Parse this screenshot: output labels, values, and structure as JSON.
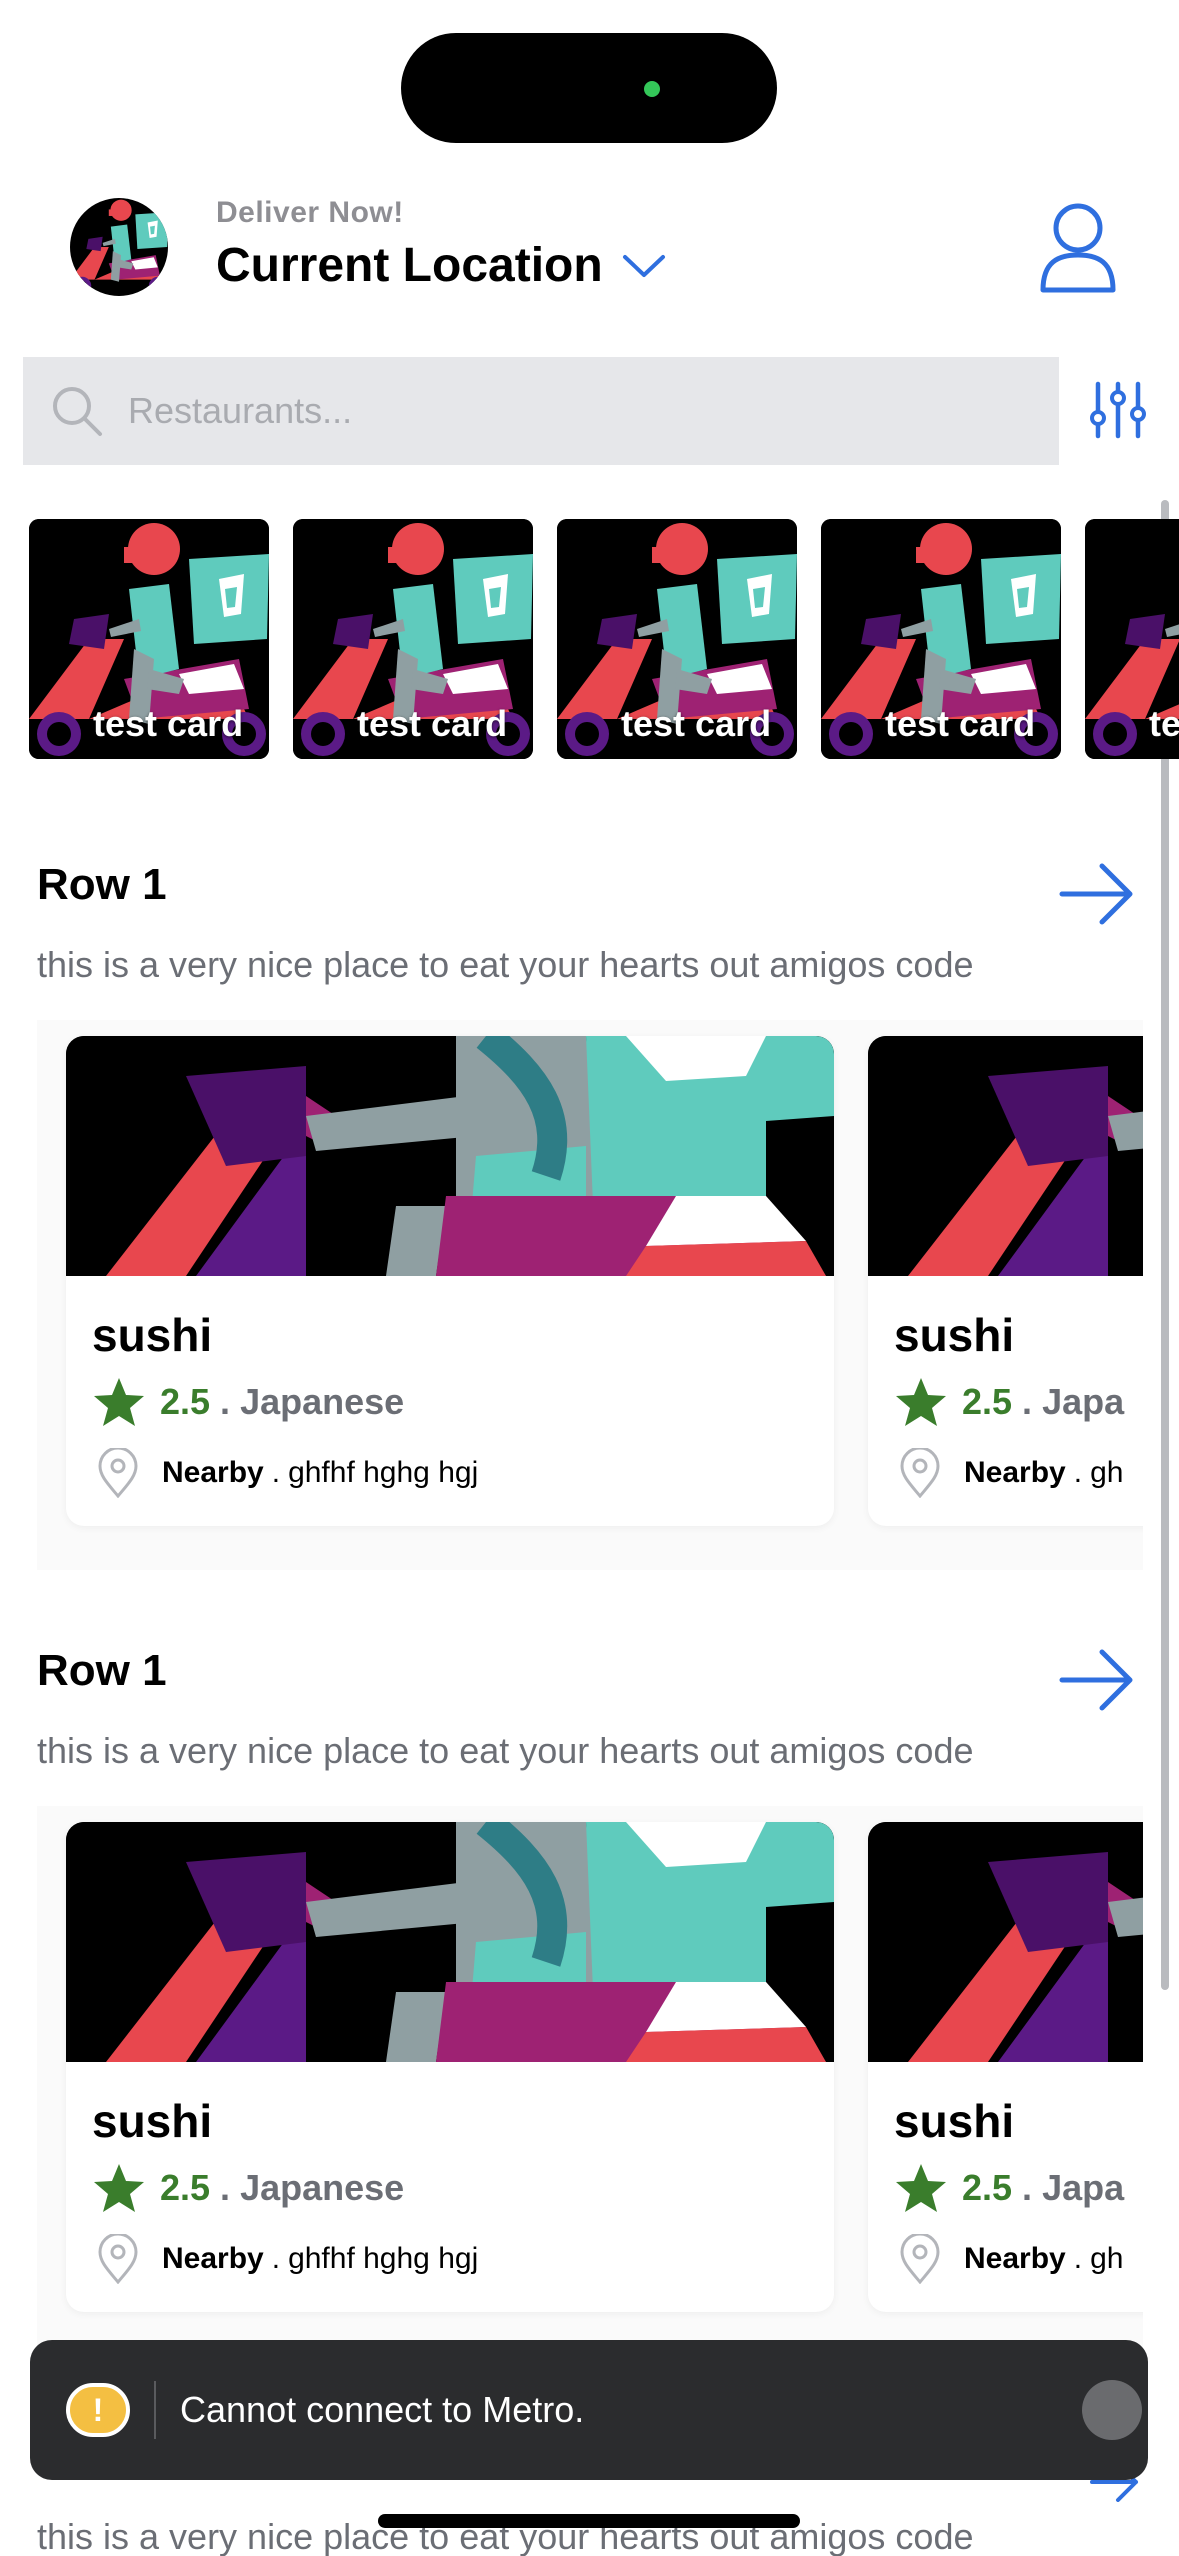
{
  "header": {
    "deliver_label": "Deliver Now!",
    "location_title": "Current Location"
  },
  "search": {
    "placeholder": "Restaurants...",
    "value": ""
  },
  "promos": [
    {
      "label": "test card"
    },
    {
      "label": "test card"
    },
    {
      "label": "test card"
    },
    {
      "label": "test card"
    },
    {
      "label": "test card"
    }
  ],
  "sections": [
    {
      "title": "Row 1",
      "description": "this is a very nice place to eat your hearts out amigos code",
      "cards": [
        {
          "name": "sushi",
          "rating": "2.5",
          "separator": ".",
          "category": "Japanese",
          "category_short": "Japa",
          "location_label": "Nearby",
          "location_sep": ".",
          "address": "ghfhf hghg hgj",
          "address_short": "gh"
        },
        {
          "name": "sushi",
          "rating": "2.5",
          "separator": ".",
          "category": "Japa",
          "location_label": "Nearby",
          "location_sep": ".",
          "address": "gh"
        }
      ]
    },
    {
      "title": "Row 1",
      "description": "this is a very nice place to eat your hearts out amigos code",
      "cards": [
        {
          "name": "sushi",
          "rating": "2.5",
          "separator": ".",
          "category": "Japanese",
          "location_label": "Nearby",
          "location_sep": ".",
          "address": "ghfhf hghg hgj"
        },
        {
          "name": "sushi",
          "rating": "2.5",
          "separator": ".",
          "category": "Japa",
          "location_label": "Nearby",
          "location_sep": ".",
          "address": "gh"
        }
      ]
    }
  ],
  "bottom_description": "this is a very nice place to eat your hearts out amigos code",
  "toast": {
    "icon": "!",
    "message": "Cannot connect to Metro."
  },
  "colors": {
    "accent": "#2f6fdf",
    "rating_green": "#3a7d2c",
    "toast_bg": "#2b2c2e",
    "warning": "#f4bf42"
  },
  "icons": [
    "avatar-logo",
    "chevron-down-icon",
    "profile-icon",
    "search-icon",
    "filter-sliders-icon",
    "arrow-right-icon",
    "star-icon",
    "location-pin-icon",
    "warning-icon"
  ]
}
